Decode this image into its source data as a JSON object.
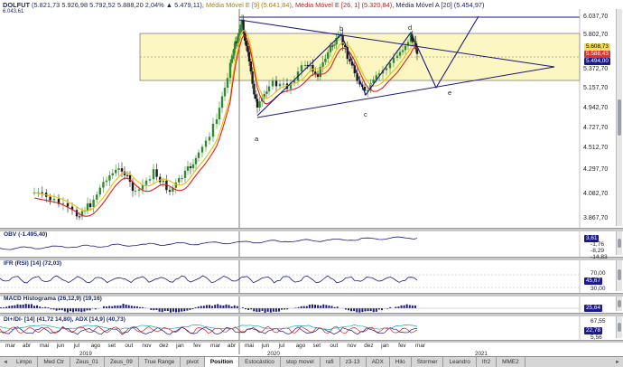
{
  "header": {
    "symbol": "DOLFUT",
    "ohlc": "(5.821,73  5.926,98  5.792,52  5.888,20  2,04%  ▲ 5.479,11)",
    "ind1": "Média Móvel E [9] (5.641,84)",
    "ind2": "Média Móvel E [26, 1] (5.320,84)",
    "ind3": "Média Móvel A [20] (5.454,97)",
    "corner_value": "6.043,61"
  },
  "price_axis": {
    "labels": [
      "6.037,70",
      "5.802,70",
      "5.607,70",
      "5.372,70",
      "5.157,70",
      "4.942,70",
      "4.727,70",
      "4.512,70",
      "4.297,70",
      "4.082,70",
      "3.867,70"
    ],
    "tags": [
      {
        "text": "5.608,73",
        "bg": "#f4e04d",
        "fg": "#000000"
      },
      {
        "text": "5.588,43",
        "bg": "#e03030",
        "fg": "#ffffff"
      },
      {
        "text": "5.494,00",
        "bg": "#1a1a8c",
        "fg": "#ffffff"
      }
    ]
  },
  "pattern_labels": {
    "a": "a",
    "b": "b",
    "c": "c",
    "d": "d",
    "e": "e"
  },
  "panels": {
    "obv": {
      "title": "OBV (-1.495,40)",
      "tag": "3,61",
      "labels": [
        "-1,76",
        "-8,29",
        "-14,83"
      ]
    },
    "rsi": {
      "title": "IFR (RSI) [14] (72,03)",
      "tag": "45,67",
      "labels": [
        "70,00",
        "30,00"
      ]
    },
    "macd": {
      "title": "MACD Histograma (26,12,9) (19,16)",
      "tag": "25,64"
    },
    "dmi": {
      "title": "DI+/DI- [14] (41,72  14,80), ADX [14,9] (40,73)",
      "tag": "22,78",
      "labels": [
        "67,55",
        "5,56"
      ]
    }
  },
  "time_axis": {
    "months": [
      "mar",
      "abr",
      "mai",
      "jun",
      "jul",
      "ago",
      "set",
      "out",
      "nov",
      "dez",
      "jan",
      "fev",
      "mar",
      "abr",
      "mai",
      "jun",
      "jul",
      "ago",
      "set",
      "out",
      "nov",
      "dez",
      "jan",
      "fev",
      "mar"
    ],
    "years": [
      "2019",
      "2020",
      "2021"
    ]
  },
  "tabs": {
    "items": [
      "Limpo",
      "Med Ctr",
      "Zeus_01",
      "Zeus_09",
      "True Range",
      "pivot",
      "Position",
      "Estocástico",
      "stop movel",
      "rafi",
      "z3-13",
      "ADX",
      "Hilo",
      "Stormer",
      "Leandro",
      "Ifr2",
      "MME2"
    ],
    "active_index": 6,
    "nav_prev": "◄",
    "nav_next": "►"
  },
  "colors": {
    "band": "#fbf6c2",
    "price_line_red": "#e02020",
    "ma_yellow": "#e8c200",
    "trendline": "#1a1a7a",
    "candle_up": "#2e8b2e",
    "candle_down": "#1a1a1a"
  },
  "icons": [
    "scrollbar-handle-icon",
    "chevron-left-icon",
    "chevron-right-icon"
  ]
}
